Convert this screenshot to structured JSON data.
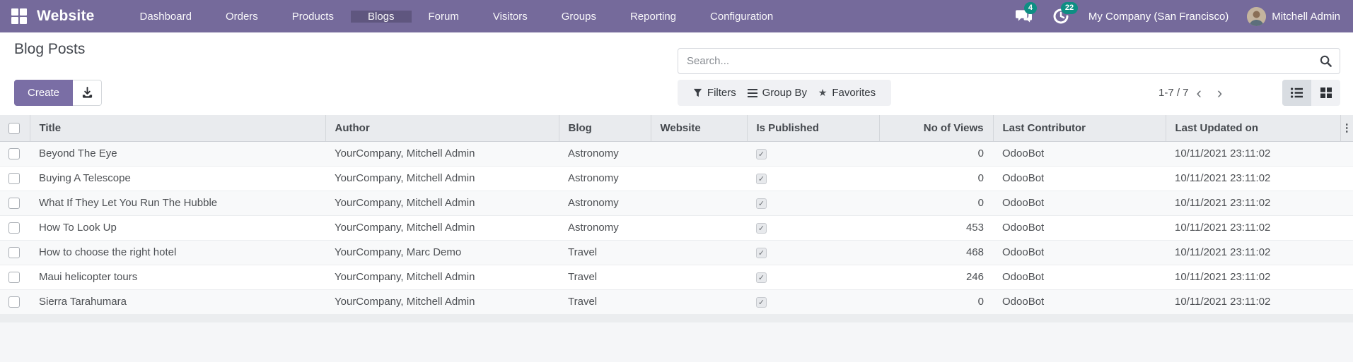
{
  "colors": {
    "navbar_bg": "#756a9b",
    "accent_purple": "#7a6ea5",
    "badge_teal": "#0e8e83",
    "annotation_red": "#e6252a"
  },
  "navbar": {
    "brand": "Website",
    "items": [
      "Dashboard",
      "Orders",
      "Products",
      "Blogs",
      "Forum",
      "Visitors",
      "Groups",
      "Reporting",
      "Configuration"
    ],
    "active_item": "Blogs",
    "systray": {
      "messages_count": "4",
      "activities_count": "22",
      "company": "My Company (San Francisco)",
      "user": "Mitchell Admin"
    }
  },
  "page": {
    "title": "Blog Posts"
  },
  "toolbar": {
    "create_label": "Create",
    "export_icon": "download-icon"
  },
  "search": {
    "placeholder": "Search...",
    "filters_label": "Filters",
    "group_by_label": "Group By",
    "favorites_label": "Favorites"
  },
  "pager": {
    "range": "1-7 / 7"
  },
  "icons": {
    "star": "★",
    "hamburger": "≡",
    "funnel": "▼",
    "dots_vertical": "⋮",
    "check": "✓",
    "chevron_left": "‹",
    "chevron_right": "›"
  },
  "table": {
    "columns": [
      "Title",
      "Author",
      "Blog",
      "Website",
      "Is Published",
      "No of Views",
      "Last Contributor",
      "Last Updated on"
    ],
    "rows": [
      {
        "title": "Beyond The Eye",
        "author": "YourCompany, Mitchell Admin",
        "blog": "Astronomy",
        "website": "",
        "is_published": true,
        "views": "0",
        "last_contributor": "OdooBot",
        "last_updated": "10/11/2021 23:11:02"
      },
      {
        "title": "Buying A Telescope",
        "author": "YourCompany, Mitchell Admin",
        "blog": "Astronomy",
        "website": "",
        "is_published": true,
        "views": "0",
        "last_contributor": "OdooBot",
        "last_updated": "10/11/2021 23:11:02"
      },
      {
        "title": "What If They Let You Run The Hubble",
        "author": "YourCompany, Mitchell Admin",
        "blog": "Astronomy",
        "website": "",
        "is_published": true,
        "views": "0",
        "last_contributor": "OdooBot",
        "last_updated": "10/11/2021 23:11:02"
      },
      {
        "title": "How To Look Up",
        "author": "YourCompany, Mitchell Admin",
        "blog": "Astronomy",
        "website": "",
        "is_published": true,
        "views": "453",
        "last_contributor": "OdooBot",
        "last_updated": "10/11/2021 23:11:02"
      },
      {
        "title": "How to choose the right hotel",
        "author": "YourCompany, Marc Demo",
        "blog": "Travel",
        "website": "",
        "is_published": true,
        "views": "468",
        "last_contributor": "OdooBot",
        "last_updated": "10/11/2021 23:11:02"
      },
      {
        "title": "Maui helicopter tours",
        "author": "YourCompany, Mitchell Admin",
        "blog": "Travel",
        "website": "",
        "is_published": true,
        "views": "246",
        "last_contributor": "OdooBot",
        "last_updated": "10/11/2021 23:11:02"
      },
      {
        "title": "Sierra Tarahumara",
        "author": "YourCompany, Mitchell Admin",
        "blog": "Travel",
        "website": "",
        "is_published": true,
        "views": "0",
        "last_contributor": "OdooBot",
        "last_updated": "10/11/2021 23:11:02"
      }
    ]
  }
}
